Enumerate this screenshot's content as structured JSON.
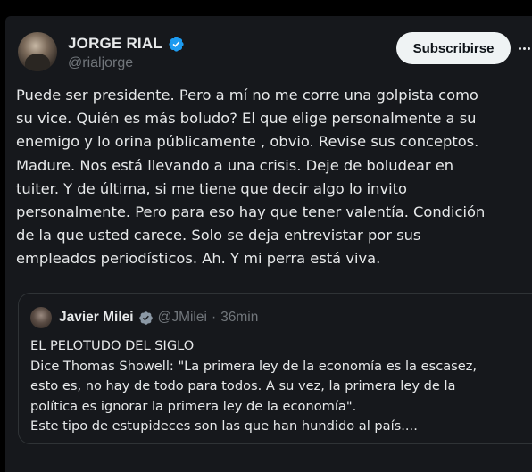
{
  "author": {
    "name": "JORGE RIAL",
    "handle": "@rialjorge"
  },
  "actions": {
    "subscribe_label": "Subscribirse"
  },
  "tweet": {
    "lines": [
      "Puede ser presidente. Pero a mí no me corre una golpista como",
      "su vice. Quién es más boludo? El que elige personalmente a su",
      "enemigo y lo orina públicamente , obvio. Revise sus conceptos.",
      "Madure. Nos está llevando a una crisis. Deje de boludear en",
      "tuiter. Y de última, si me tiene que decir algo lo invito",
      "personalmente. Pero para eso hay que tener valentía. Condición",
      "de la que usted carece. Solo se deja entrevistar por sus",
      "empleados periodísticos. Ah. Y mi perra está viva."
    ]
  },
  "quote": {
    "name": "Javier Milei",
    "handle": "@JMilei",
    "separator": "·",
    "time": "36min",
    "lines": [
      "EL PELOTUDO DEL SIGLO",
      "Dice Thomas Showell: \"La primera ley de la economía es la escasez,",
      "esto es, no hay de todo para todos. A su vez, la primera ley de la",
      "política es ignorar la primera ley de la economía\".",
      "Este tipo de estupideces son las que han hundido al país...."
    ]
  },
  "icons": {
    "verified": "verified-badge-icon",
    "more": "more-options-icon"
  },
  "colors": {
    "background": "#000000",
    "card": "#16181c",
    "text": "#e7e9ea",
    "muted": "#71767b",
    "verified": "#1d9bf0",
    "button_bg": "#eff3f4"
  }
}
